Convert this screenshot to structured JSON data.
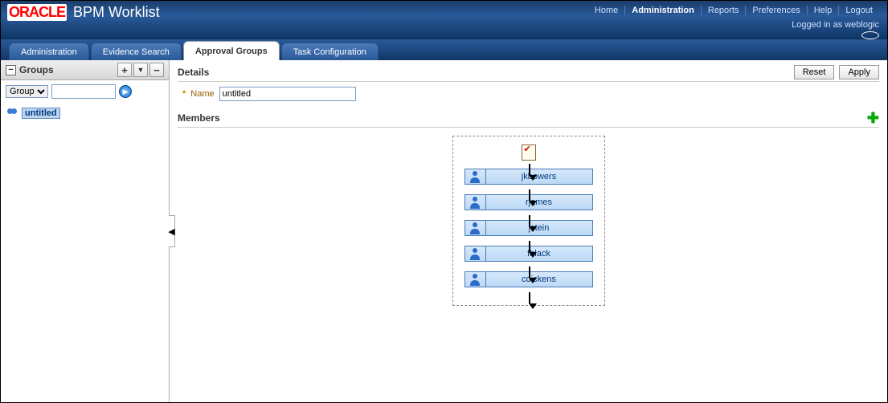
{
  "header": {
    "logo_text": "ORACLE",
    "app_title": "BPM Worklist",
    "links": {
      "home": "Home",
      "admin": "Administration",
      "reports": "Reports",
      "prefs": "Preferences",
      "help": "Help",
      "logout": "Logout"
    },
    "login_status": "Logged in as weblogic"
  },
  "tabs": {
    "admin": "Administration",
    "evidence": "Evidence Search",
    "approval": "Approval Groups",
    "task": "Task Configuration"
  },
  "sidebar": {
    "title": "Groups",
    "filter_option": "Group",
    "tree_item": "untitled"
  },
  "details": {
    "title": "Details",
    "reset": "Reset",
    "apply": "Apply",
    "name_label": "Name",
    "name_value": "untitled",
    "members_title": "Members",
    "members": [
      "jkbowers",
      "rjames",
      "jstein",
      "fblack",
      "cdickens"
    ]
  }
}
